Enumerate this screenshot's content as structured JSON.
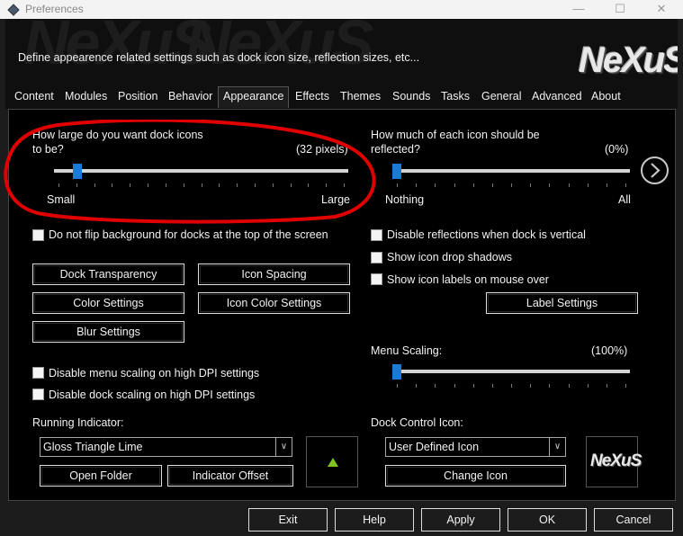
{
  "window": {
    "title": "Preferences",
    "controls": [
      "—",
      "☐",
      "✕"
    ]
  },
  "header": {
    "description": "Define appearence related settings such as dock icon size, reflection sizes, etc...",
    "logo": "NeXuS",
    "watermark": "NeXuS"
  },
  "tabs": [
    "Content",
    "Modules",
    "Position",
    "Behavior",
    "Appearance",
    "Effects",
    "Themes",
    "Sounds",
    "Tasks",
    "General",
    "Advanced",
    "About"
  ],
  "active_tab": "Appearance",
  "icon_size": {
    "question_line1": "How large do you want dock icons",
    "question_line2": "to be?",
    "value_text": "(32 pixels)",
    "value": 32,
    "min_label": "Small",
    "max_label": "Large",
    "fraction": 0.08
  },
  "reflection": {
    "question_line1": "How much of each icon should be",
    "question_line2": "reflected?",
    "value_text": "(0%)",
    "value": 0,
    "min_label": "Nothing",
    "max_label": "All"
  },
  "checkboxes": {
    "no_flip": "Do not flip background for docks at the top of the screen",
    "disable_reflections_vertical": "Disable reflections when dock is vertical",
    "show_drop_shadows": "Show icon drop shadows",
    "show_labels": "Show icon labels on mouse over",
    "disable_menu_scaling": "Disable menu scaling on high DPI settings",
    "disable_dock_scaling": "Disable dock scaling on high DPI settings"
  },
  "buttons": {
    "dock_transparency": "Dock Transparency",
    "icon_spacing": "Icon Spacing",
    "color_settings": "Color Settings",
    "icon_color_settings": "Icon Color Settings",
    "blur_settings": "Blur Settings",
    "label_settings": "Label Settings",
    "open_folder": "Open Folder",
    "indicator_offset": "Indicator Offset",
    "change_icon": "Change Icon"
  },
  "menu_scaling": {
    "label": "Menu Scaling:",
    "value_text": "(100%)",
    "value": 100
  },
  "running_indicator": {
    "label": "Running Indicator:",
    "selected": "Gloss Triangle Lime",
    "preview_color": "#7fc41e"
  },
  "dock_control_icon": {
    "label": "Dock Control Icon:",
    "selected": "User Defined Icon",
    "preview_logo": "NeXuS"
  },
  "footer": {
    "exit": "Exit",
    "help": "Help",
    "apply": "Apply",
    "ok": "OK",
    "cancel": "Cancel"
  },
  "next_page_icon": "chevron-right-circle-icon",
  "colors": {
    "accent": "#1a7ad4",
    "annotation": "#e00000",
    "background": "#000000"
  }
}
